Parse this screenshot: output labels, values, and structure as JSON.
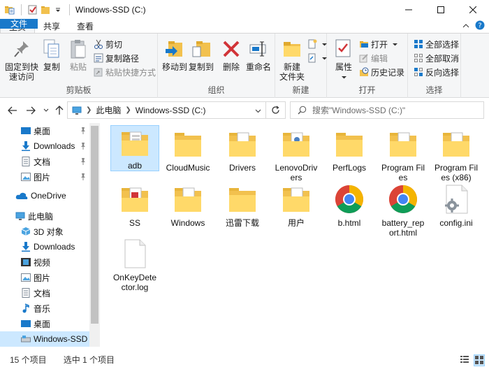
{
  "window": {
    "title": "Windows-SSD (C:)",
    "quick_access": [
      "folder-properties-icon",
      "checkmark-icon",
      "new-folder-icon",
      "customize-chevron-icon"
    ]
  },
  "tabs": [
    {
      "label": "文件"
    },
    {
      "label": "主页"
    },
    {
      "label": "共享"
    },
    {
      "label": "查看"
    }
  ],
  "ribbon": {
    "clipboard": {
      "label": "剪贴板",
      "pin": "固定到快\n速访问",
      "copy": "复制",
      "paste": "粘贴",
      "cut": "剪切",
      "copy_path": "复制路径",
      "paste_shortcut": "粘贴快捷方式"
    },
    "organize": {
      "label": "组织",
      "move_to": "移动到",
      "copy_to": "复制到",
      "delete": "删除",
      "rename": "重命名"
    },
    "new": {
      "label": "新建",
      "new_folder": "新建\n文件夹"
    },
    "open": {
      "label": "打开",
      "properties": "属性",
      "open": "打开",
      "edit": "编辑",
      "history": "历史记录"
    },
    "select": {
      "label": "选择",
      "select_all": "全部选择",
      "select_none": "全部取消",
      "invert": "反向选择"
    }
  },
  "address": {
    "crumbs": [
      "此电脑",
      "Windows-SSD (C:)"
    ],
    "search_placeholder": "搜索\"Windows-SSD (C:)\""
  },
  "navpane": {
    "items": [
      {
        "label": "桌面",
        "icon": "desktop-icon",
        "pinned": true
      },
      {
        "label": "Downloads",
        "icon": "downloads-icon",
        "pinned": true
      },
      {
        "label": "文档",
        "icon": "documents-icon",
        "pinned": true
      },
      {
        "label": "图片",
        "icon": "pictures-icon",
        "pinned": true
      },
      {
        "label": "OneDrive",
        "icon": "onedrive-icon"
      },
      {
        "label": "此电脑",
        "icon": "this-pc-icon"
      },
      {
        "label": "3D 对象",
        "icon": "3d-objects-icon"
      },
      {
        "label": "Downloads",
        "icon": "downloads-icon"
      },
      {
        "label": "视频",
        "icon": "videos-icon"
      },
      {
        "label": "图片",
        "icon": "pictures-icon"
      },
      {
        "label": "文档",
        "icon": "documents-icon"
      },
      {
        "label": "音乐",
        "icon": "music-icon"
      },
      {
        "label": "桌面",
        "icon": "desktop-icon"
      },
      {
        "label": "Windows-SSD (",
        "icon": "drive-icon",
        "selected": true
      }
    ]
  },
  "files": [
    {
      "name": "adb",
      "type": "folder-doc",
      "selected": true
    },
    {
      "name": "CloudMusic",
      "type": "folder"
    },
    {
      "name": "Drivers",
      "type": "folder-doc"
    },
    {
      "name": "LenovoDrivers",
      "type": "folder-doc"
    },
    {
      "name": "PerfLogs",
      "type": "folder"
    },
    {
      "name": "Program Files",
      "type": "folder-doc"
    },
    {
      "name": "Program Files (x86)",
      "type": "folder-doc"
    },
    {
      "name": "SS",
      "type": "folder-pdf"
    },
    {
      "name": "Windows",
      "type": "folder-doc"
    },
    {
      "name": "迅雷下载",
      "type": "folder"
    },
    {
      "name": "用户",
      "type": "folder-doc"
    },
    {
      "name": "b.html",
      "type": "chrome"
    },
    {
      "name": "battery_report.html",
      "type": "chrome"
    },
    {
      "name": "config.ini",
      "type": "ini"
    },
    {
      "name": "OnKeyDetector.log",
      "type": "blank"
    }
  ],
  "status": {
    "count": "15 个项目",
    "selected": "选中 1 个项目"
  },
  "colors": {
    "file_tab": "#1979ca",
    "selection": "#cce8ff",
    "folder": "#ffd969"
  }
}
